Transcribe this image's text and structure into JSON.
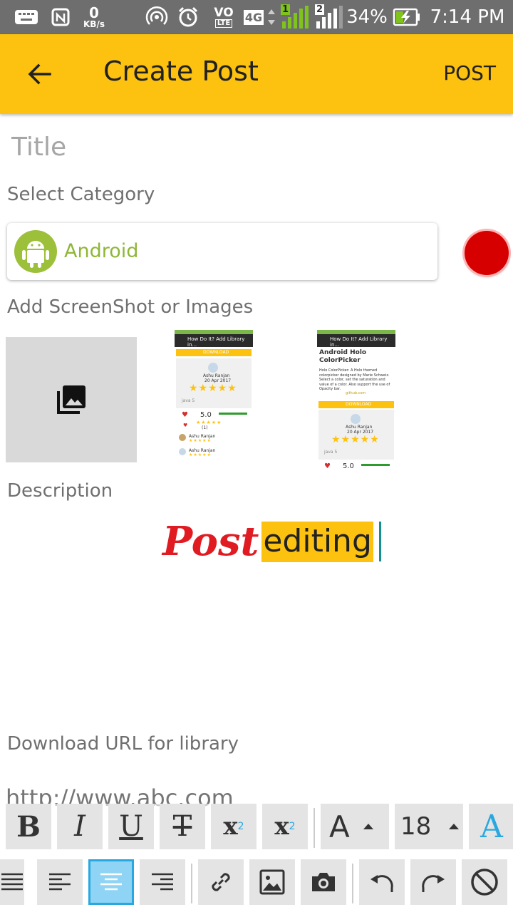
{
  "status_bar": {
    "net_speed_value": "0",
    "net_speed_unit": "KB/s",
    "lte_badge": "LTE",
    "vo_badge": "VO",
    "network_type": "4G",
    "sim1": "1",
    "sim2": "2",
    "battery": "34%",
    "time": "7:14 PM",
    "icons": [
      "keyboard-icon",
      "nfc-icon",
      "hotspot-icon",
      "alarm-icon",
      "volte-icon",
      "signal-icon",
      "battery-charging-icon"
    ]
  },
  "app_bar": {
    "title": "Create Post",
    "action": "POST",
    "back_icon": "arrow-left-icon",
    "background": "#fdc20f"
  },
  "form": {
    "title_placeholder": "Title",
    "category_label": "Select Category",
    "category_value": "Android",
    "category_icon": "android-icon",
    "images_label": "Add ScreenShot or Images",
    "add_image_icon": "photo-library-icon",
    "description_label": "Description",
    "description": {
      "script_word": "Post",
      "highlighted_word": "editing"
    },
    "download_label": "Download URL for library",
    "download_placeholder": "http://www.abc.com"
  },
  "thumbnails": [
    {
      "appbar_text": "How Do It? Add Library in...",
      "button_text": "DOWNLOAD",
      "name_line": "Ashu Ranjan",
      "date_line": "20 Apr 2017",
      "tag": "java 5",
      "rating": "5.0",
      "rating_count": "(1)",
      "reviewer1": "Ashu Ranjan",
      "reviewer2": "Ashu Ranjan"
    },
    {
      "appbar_text": "How Do It? Add Library in...",
      "heading": "Android Holo ColorPicker",
      "body": "Holo ColorPicker: A Holo themed colorpicker designed by Marie Schweiz. Select a color, set the saturation and value of a color. Also support the use of Opacity bar.",
      "link": "github.com",
      "button_text": "DOWNLOAD",
      "name_line": "Ashu Ranjan",
      "date_line": "20 Apr 2017",
      "tag": "java 5",
      "rating": "5.0"
    }
  ],
  "toolbar": {
    "row1": [
      {
        "name": "bold-button",
        "label": "B"
      },
      {
        "name": "italic-button",
        "label": "I"
      },
      {
        "name": "underline-button",
        "label": "U"
      },
      {
        "name": "strikethrough-button",
        "label": "T"
      },
      {
        "name": "superscript-button",
        "label": "x",
        "sup": "2"
      },
      {
        "name": "subscript-button",
        "label": "x",
        "sub": "2"
      },
      {
        "name": "font-family-button",
        "label": "A"
      },
      {
        "name": "font-size-value",
        "label": "18"
      },
      {
        "name": "text-color-button",
        "label": "A"
      }
    ],
    "row2_icons": [
      "justify-icon",
      "align-left-icon",
      "align-center-icon",
      "align-right-icon",
      "link-icon",
      "image-icon",
      "camera-icon",
      "undo-icon",
      "redo-icon",
      "clear-format-icon"
    ],
    "active": "align-center-icon",
    "accent": "#29a8e0"
  },
  "colors": {
    "record_button": "#d60000",
    "android_green": "#9cc03a",
    "post_red": "#e01b22"
  }
}
